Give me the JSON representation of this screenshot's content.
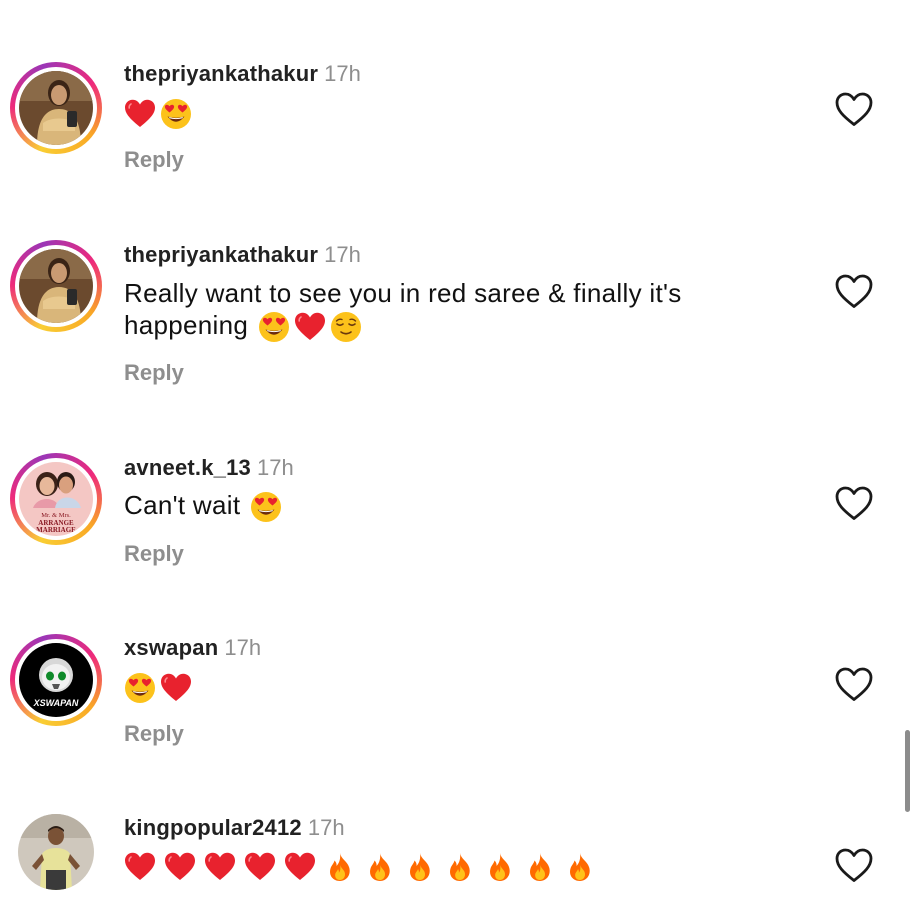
{
  "comments": [
    {
      "username": "thepriyankathakur",
      "time": "17h",
      "text": "",
      "emoji": [
        "red-heart-emoji",
        "heart-eyes-emoji"
      ],
      "reply": "Reply"
    },
    {
      "username": "thepriyankathakur",
      "time": "17h",
      "text_line1": "Really want to see you in red saree & finally it's",
      "text_line2": "happening",
      "emoji": [
        "heart-eyes-emoji",
        "red-heart-emoji",
        "relieved-face-emoji"
      ],
      "reply": "Reply"
    },
    {
      "username": "avneet.k_13",
      "time": "17h",
      "text": "Can't wait",
      "emoji": [
        "heart-eyes-emoji"
      ],
      "reply": "Reply",
      "avatar_caption_1": "Mr. & Mrs.",
      "avatar_caption_2": "ARRANGE",
      "avatar_caption_3": "MARRIAGE"
    },
    {
      "username": "xswapan",
      "time": "17h",
      "text": "",
      "emoji": [
        "heart-eyes-emoji",
        "red-heart-emoji"
      ],
      "reply": "Reply",
      "avatar_caption": "XSWAPAN"
    },
    {
      "username": "kingpopular2412",
      "time": "17h",
      "text": "",
      "emoji": [
        "red-heart-emoji x5",
        "fire-emoji x7"
      ]
    }
  ],
  "colors": {
    "username": "#222222",
    "meta_gray": "#8e8e8e",
    "heart_red": "#e8222e",
    "fire_orange": "#ff7a00",
    "story_ring": "#ee2a7b"
  },
  "icons": {
    "like": "heart-outline-icon"
  }
}
